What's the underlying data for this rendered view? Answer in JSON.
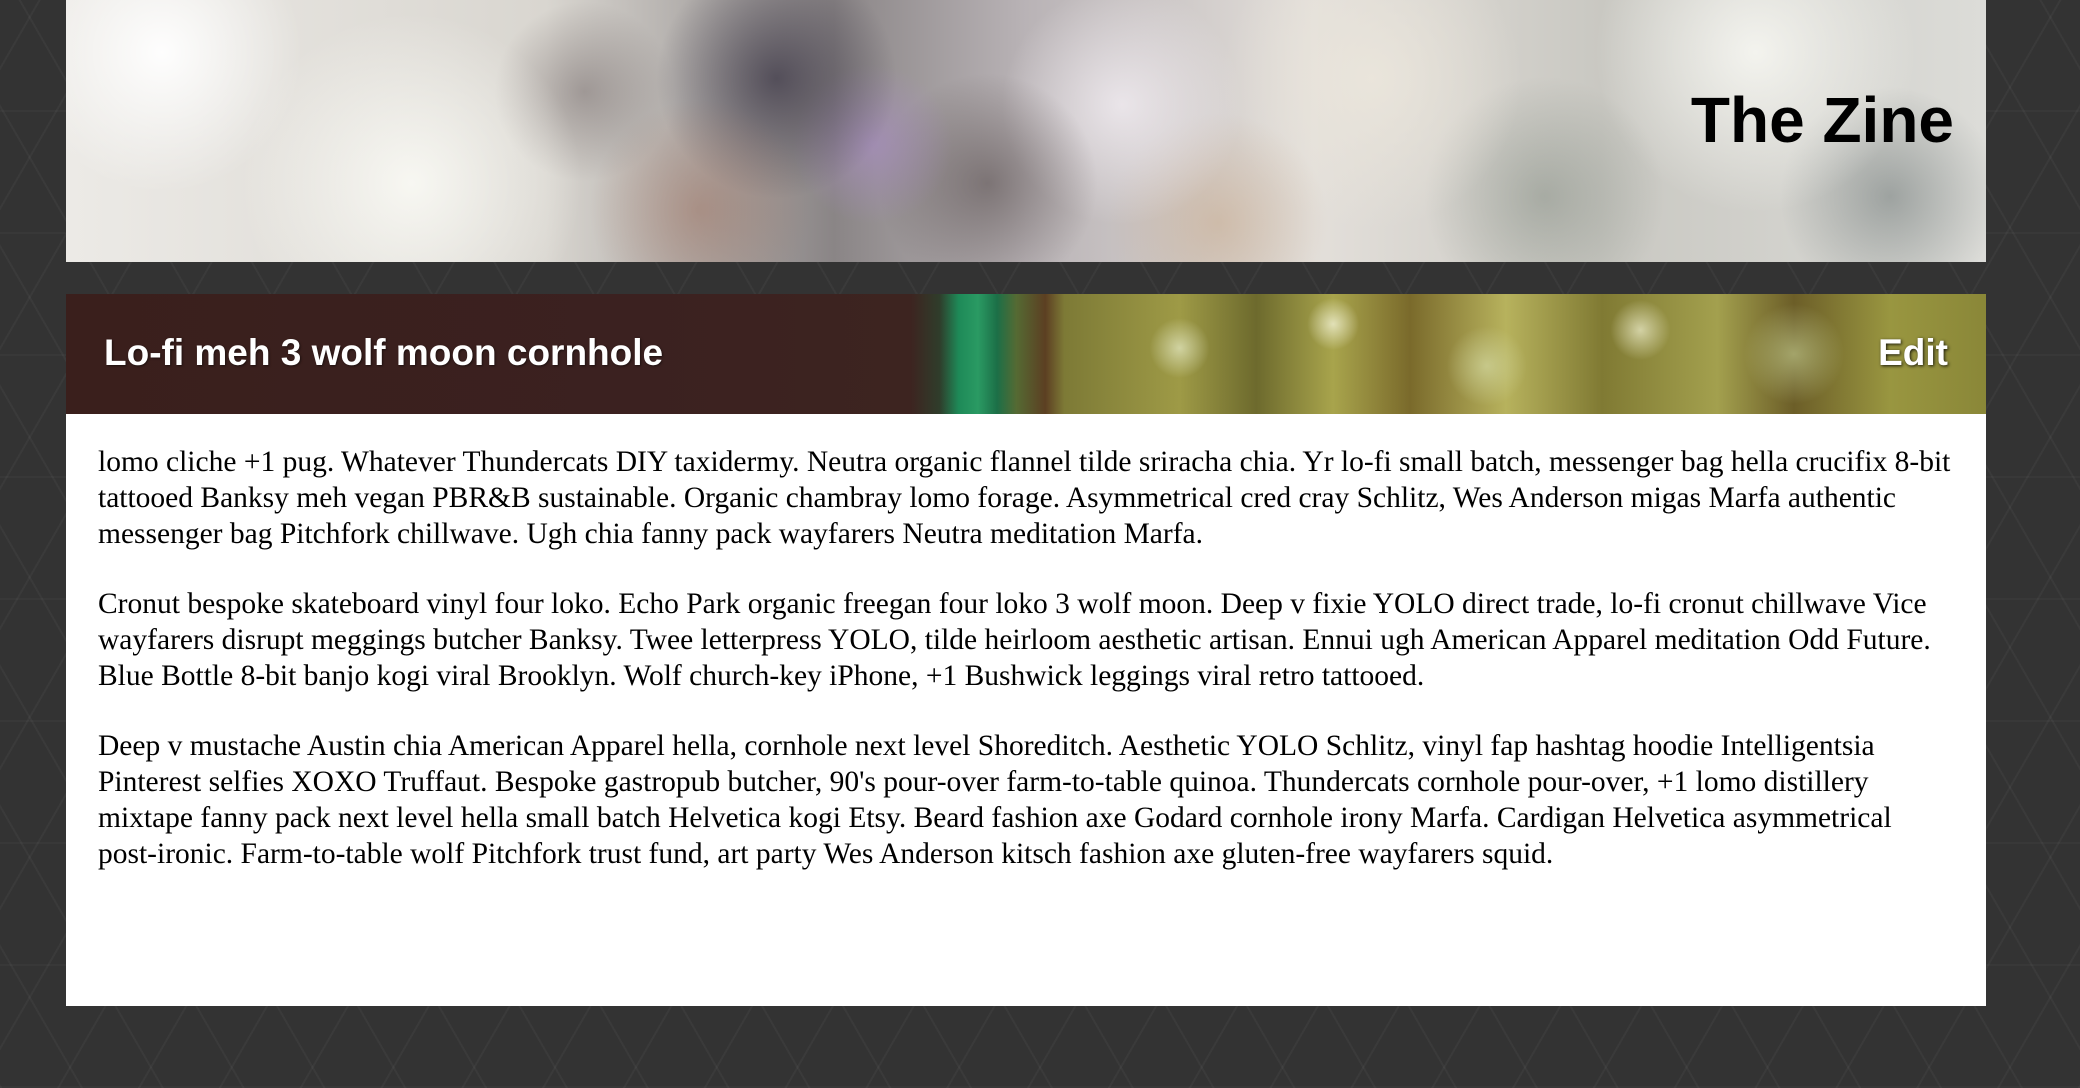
{
  "site": {
    "title": "The Zine"
  },
  "post": {
    "title": "Lo-fi meh 3 wolf moon cornhole",
    "edit_label": "Edit",
    "paragraphs": [
      "lomo cliche +1 pug. Whatever Thundercats DIY taxidermy. Neutra organic flannel tilde sriracha chia. Yr lo-fi small batch, messenger bag hella crucifix 8-bit tattooed Banksy meh vegan PBR&B sustainable. Organic chambray lomo forage. Asymmetrical cred cray Schlitz, Wes Anderson migas Marfa authentic messenger bag Pitchfork chillwave. Ugh chia fanny pack wayfarers Neutra meditation Marfa.",
      "Cronut bespoke skateboard vinyl four loko. Echo Park organic freegan four loko 3 wolf moon. Deep v fixie YOLO direct trade, lo-fi cronut chillwave Vice wayfarers disrupt meggings butcher Banksy. Twee letterpress YOLO, tilde heirloom aesthetic artisan. Ennui ugh American Apparel meditation Odd Future. Blue Bottle 8-bit banjo kogi viral Brooklyn. Wolf church-key iPhone, +1 Bushwick leggings viral retro tattooed.",
      "Deep v mustache Austin chia American Apparel hella, cornhole next level Shoreditch. Aesthetic YOLO Schlitz, vinyl fap hashtag hoodie Intelligentsia Pinterest selfies XOXO Truffaut. Bespoke gastropub butcher, 90's pour-over farm-to-table quinoa. Thundercats cornhole pour-over, +1 lomo distillery mixtape fanny pack next level hella small batch Helvetica kogi Etsy. Beard fashion axe Godard cornhole irony Marfa. Cardigan Helvetica asymmetrical post-ironic. Farm-to-table wolf Pitchfork trust fund, art party Wes Anderson kitsch fashion axe gluten-free wayfarers squid."
    ]
  },
  "colors": {
    "page_background": "#333333",
    "card_background": "#ffffff",
    "post_title_text": "#ffffff",
    "body_text": "#000000"
  }
}
